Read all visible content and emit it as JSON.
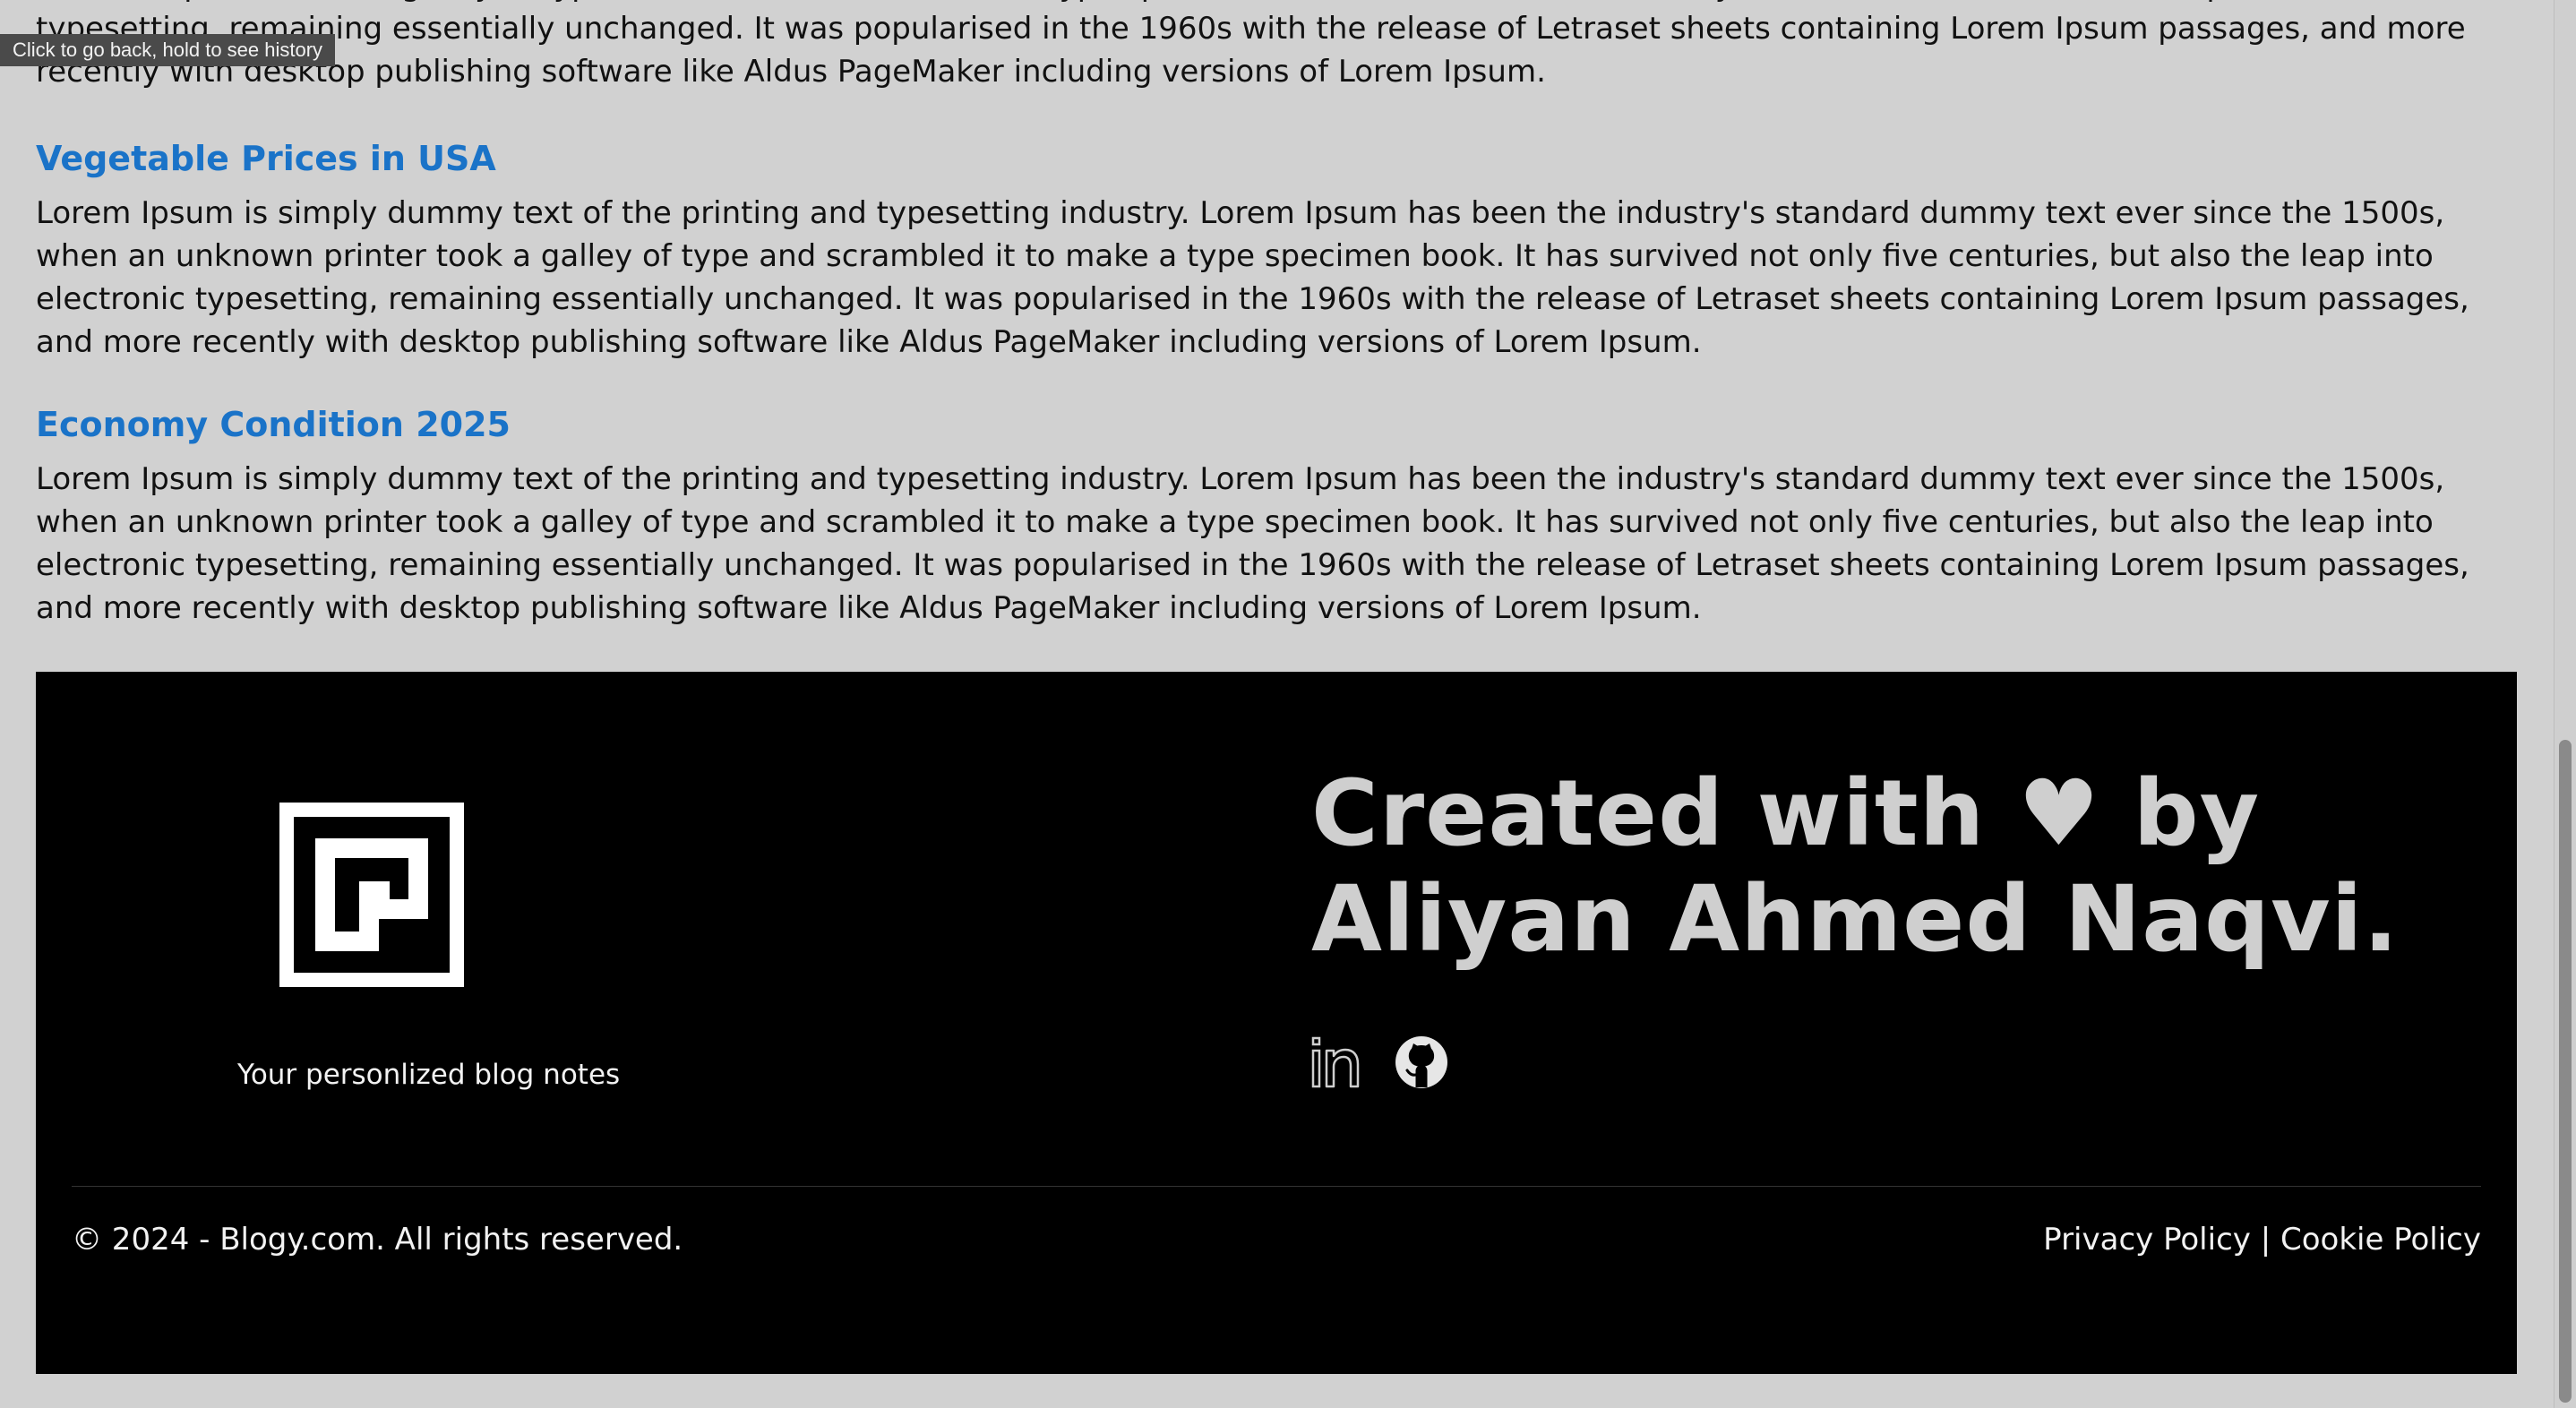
{
  "tooltip": "Click to go back, hold to see history",
  "top_paragraph": "unknown printer took a galley of type and scrambled it to make a type specimen book. It has survived not only five centuries, but also the leap into electronic typesetting, remaining essentially unchanged. It was popularised in the 1960s with the release of Letraset sheets containing Lorem Ipsum passages, and more recently with desktop publishing software like Aldus PageMaker including versions of Lorem Ipsum.",
  "articles": [
    {
      "title": "Vegetable Prices in USA",
      "body": "Lorem Ipsum is simply dummy text of the printing and typesetting industry. Lorem Ipsum has been the industry's standard dummy text ever since the 1500s, when an unknown printer took a galley of type and scrambled it to make a type specimen book. It has survived not only five centuries, but also the leap into electronic typesetting, remaining essentially unchanged. It was popularised in the 1960s with the release of Letraset sheets containing Lorem Ipsum passages, and more recently with desktop publishing software like Aldus PageMaker including versions of Lorem Ipsum."
    },
    {
      "title": "Economy Condition 2025",
      "body": "Lorem Ipsum is simply dummy text of the printing and typesetting industry. Lorem Ipsum has been the industry's standard dummy text ever since the 1500s, when an unknown printer took a galley of type and scrambled it to make a type specimen book. It has survived not only five centuries, but also the leap into electronic typesetting, remaining essentially unchanged. It was popularised in the 1960s with the release of Letraset sheets containing Lorem Ipsum passages, and more recently with desktop publishing software like Aldus PageMaker including versions of Lorem Ipsum."
    }
  ],
  "footer": {
    "tagline": "Your personlized blog notes",
    "credit_line1": "Created with ♥ by",
    "credit_line2": "Aliyan Ahmed Naqvi.",
    "social_icons": [
      "linkedin-icon",
      "github-icon"
    ],
    "copyright": "© 2024 - Blogy.com. All rights reserved.",
    "privacy_label": "Privacy Policy",
    "separator": "|",
    "cookie_label": "Cookie Policy"
  },
  "colors": {
    "page_bg": "#d1d1d1",
    "heading_blue": "#1a73c8",
    "footer_bg": "#000000",
    "credit_text": "#cfcfcf"
  }
}
